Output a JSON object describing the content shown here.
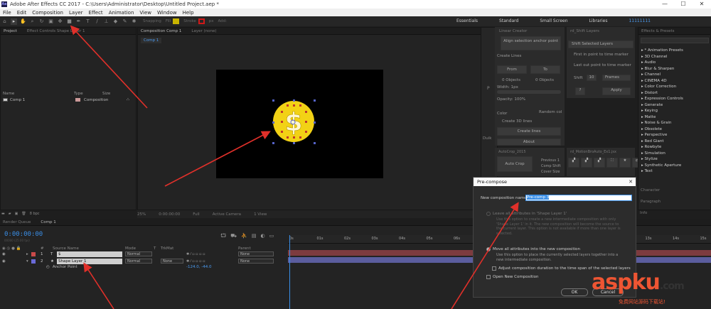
{
  "window": {
    "title": "Adobe After Effects CC 2017 - C:\\Users\\Administrator\\Desktop\\Untitled Project.aep *",
    "controls": [
      "—",
      "☐",
      "✕"
    ]
  },
  "menu": [
    "File",
    "Edit",
    "Composition",
    "Layer",
    "Effect",
    "Animation",
    "View",
    "Window",
    "Help"
  ],
  "toolbar": {
    "snapping": "Snapping",
    "fill": "Fill",
    "stroke": "Stroke",
    "stroke_width": "px",
    "add": "Add:",
    "fill_color": "#c8b400",
    "stroke_color": "#d01818"
  },
  "workspaces": {
    "items": [
      "Essentials",
      "Standard",
      "Small Screen",
      "Libraries"
    ],
    "search_value": "11111111"
  },
  "project_panel": {
    "tabs": [
      "Project",
      "Effect Controls Shape Layer 1"
    ],
    "columns": [
      "Name",
      "Type",
      "Size"
    ],
    "items": [
      {
        "name": "Comp 1",
        "type": "Composition"
      }
    ],
    "footer_bpc": "8 bpc"
  },
  "composition_panel": {
    "tabs": [
      "Composition Comp 1",
      "Layer (none)"
    ],
    "comp_tab": "Comp 1",
    "footer": [
      "25%",
      "0:00:00:00",
      "Full",
      "Active Camera",
      "1 View"
    ]
  },
  "timeline": {
    "tabs": [
      "Render Queue",
      "Comp 1"
    ],
    "timecode": "0:00:00:00",
    "fps": "00000 (25.00 fps)",
    "columns": {
      "num": "#",
      "source": "Source Name",
      "mode": "Mode",
      "t": "T",
      "trkmat": "TrkMat",
      "parent": "Parent"
    },
    "layers": [
      {
        "num": "1",
        "name": "$",
        "mode": "Normal",
        "trkmat": "",
        "parent": "None",
        "color": "#c94a4a"
      },
      {
        "num": "2",
        "name": "Shape Layer 1",
        "mode": "Normal",
        "trkmat": "None",
        "parent": "None",
        "color": "#6a6ad8"
      }
    ],
    "sub_property": {
      "name": "Anchor Point",
      "value": "-124.0, -44.0"
    },
    "ruler": [
      "0s",
      "01s",
      "02s",
      "03s",
      "04s",
      "05s",
      "06s",
      "07s",
      "08s",
      "09s",
      "10s",
      "11s",
      "12s",
      "13s",
      "14s",
      "15s"
    ]
  },
  "scripts": {
    "linear_creator": {
      "title": "Linear Creator",
      "align_button": "Align selection anchor point",
      "create_lines": "Create Lines",
      "from": "From",
      "to": "To",
      "from_objects": "0 Objects",
      "to_objects": "0 Objects",
      "width": "Width: 1px",
      "opacity": "Opacity: 100%",
      "color": "Color",
      "random_col": "Random col",
      "create_3d": "Create 3D lines",
      "create_btn": "Create lines",
      "about": "About"
    },
    "shift_layers": {
      "title": "rd_Shift Layers",
      "shift_selected": "Shift Selected Layers",
      "first_in_point": "First in point to time marker",
      "last_out_point": "Last out point to time marker",
      "shift": "Shift",
      "shift_value": "10",
      "frames": "Frames",
      "help": "?",
      "apply": "Apply"
    },
    "auto_crop": {
      "title": "AutoCrop_2015",
      "button": "Auto Crop",
      "prev1": "Previous 1",
      "prev2": "Comp Shift",
      "prev3": "Cover Size"
    },
    "motion_bro": {
      "title": "rd_MotionBroAuto_Ex1.jsx"
    },
    "side_labels": {
      "p": "P",
      "duik": "Duik"
    }
  },
  "effects_presets": {
    "title": "Effects & Presets",
    "items": [
      "* Animation Presets",
      "3D Channel",
      "Audio",
      "Blur & Sharpen",
      "Channel",
      "CINEMA 4D",
      "Color Correction",
      "Distort",
      "Expression Controls",
      "Generate",
      "Keying",
      "Matte",
      "Noise & Grain",
      "Obsolete",
      "Perspective",
      "Red Giant",
      "Rowbyte",
      "Simulation",
      "Stylize",
      "Synthetic Aperture",
      "Text"
    ],
    "lower_panels": [
      "Character",
      "Paragraph",
      "Info"
    ]
  },
  "dialog": {
    "title": "Pre-compose",
    "name_label": "New composition name:",
    "name_value": "Pre-comp 3",
    "option1": "Leave all attributes in 'Shape Layer 1'",
    "option1_desc": "Use this option to create a new intermediate composition with only 'Shape Layer 1' in it. The new composition will become the source to the current layer. This option is not available if more than one layer is selected.",
    "option2": "Move all attributes into the new composition",
    "option2_desc": "Use this option to place the currently selected layers together into a new intermediate composition.",
    "adjust_duration": "Adjust composition duration to the time span of the selected layers",
    "open_new": "Open New Composition",
    "ok": "OK",
    "cancel": "Cancel"
  },
  "watermark": {
    "logo": "aspku",
    "suffix": ".com",
    "sub": "免费网站源码下载站!"
  }
}
